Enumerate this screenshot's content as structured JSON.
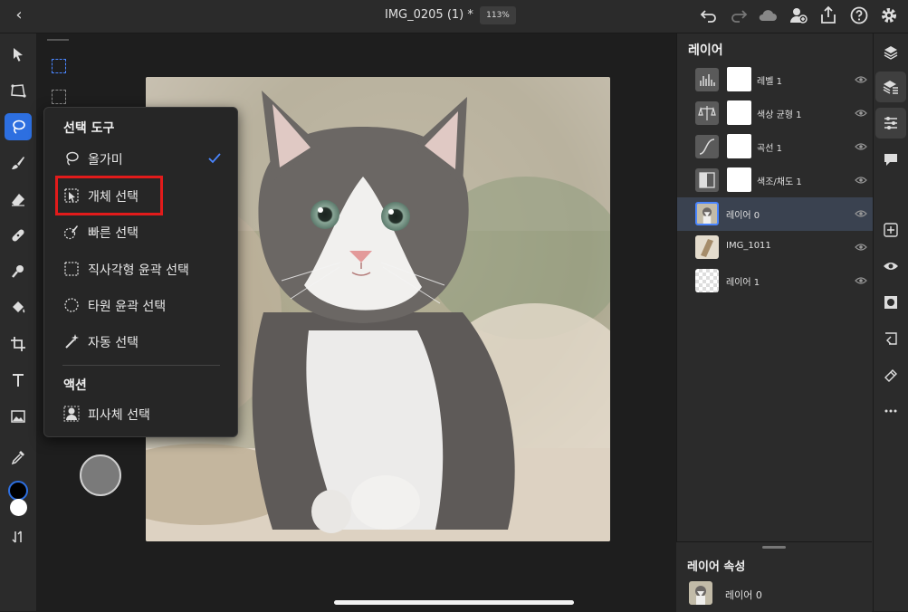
{
  "topbar": {
    "title": "IMG_0205 (1) *",
    "zoom": "113%"
  },
  "menu": {
    "section_select": "선택 도구",
    "items": [
      {
        "label": "올가미",
        "icon": "lasso-icon",
        "checked": true
      },
      {
        "label": "개체 선택",
        "icon": "object-select-icon"
      },
      {
        "label": "빠른 선택",
        "icon": "quick-select-icon"
      },
      {
        "label": "직사각형 윤곽 선택",
        "icon": "rect-marquee-icon"
      },
      {
        "label": "타원 윤곽 선택",
        "icon": "ellipse-marquee-icon"
      },
      {
        "label": "자동 선택",
        "icon": "magic-wand-icon"
      }
    ],
    "section_action": "액션",
    "action_item": {
      "label": "피사체 선택",
      "icon": "select-subject-icon"
    }
  },
  "layers": {
    "title": "레이어",
    "rows": [
      {
        "name": "레벨 1",
        "type": "levels",
        "has_mask": true,
        "selected": false
      },
      {
        "name": "색상 균형 1",
        "type": "color-balance",
        "has_mask": true,
        "selected": false
      },
      {
        "name": "곡선 1",
        "type": "curves",
        "has_mask": true,
        "selected": false
      },
      {
        "name": "색조/채도 1",
        "type": "hue-saturation",
        "has_mask": true,
        "selected": false
      },
      {
        "name": "레이어 0",
        "type": "image",
        "has_mask": false,
        "selected": true
      },
      {
        "name": "IMG_1011",
        "type": "image",
        "has_mask": false,
        "selected": false
      },
      {
        "name": "레이어 1",
        "type": "empty",
        "has_mask": false,
        "selected": false
      }
    ]
  },
  "properties": {
    "title": "레이어 속성",
    "layer_name": "레이어 0"
  },
  "colors": {
    "accent": "#2d6fe0",
    "highlight_box": "#e21b1b",
    "foreground_swatch": "#000000",
    "background_swatch": "#ffffff"
  }
}
